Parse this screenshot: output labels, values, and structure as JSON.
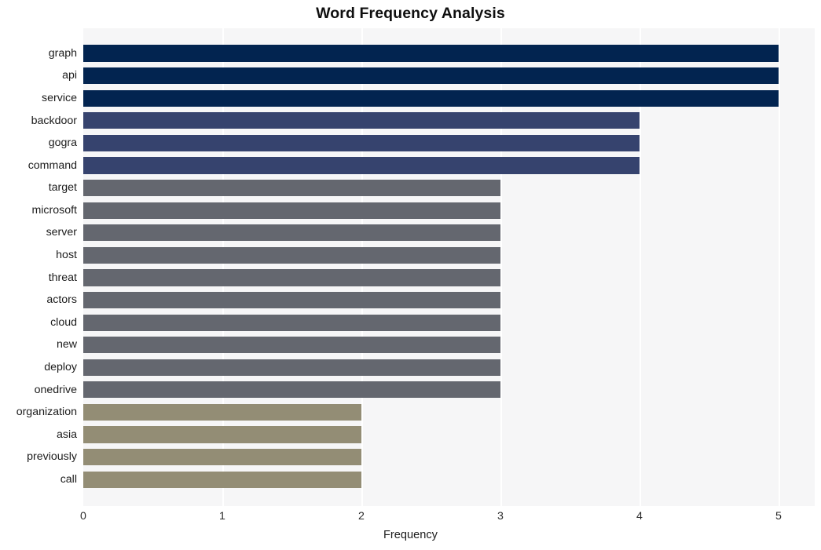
{
  "chart_data": {
    "type": "bar",
    "orientation": "horizontal",
    "title": "Word Frequency Analysis",
    "xlabel": "Frequency",
    "ylabel": "",
    "xlim": [
      0,
      5
    ],
    "xticks": [
      0,
      1,
      2,
      3,
      4,
      5
    ],
    "xtick_labels": [
      "0",
      "1",
      "2",
      "3",
      "4",
      "5"
    ],
    "grid": true,
    "grid_axis": "x",
    "legend": "none",
    "categories": [
      "graph",
      "api",
      "service",
      "backdoor",
      "gogra",
      "command",
      "target",
      "microsoft",
      "server",
      "host",
      "threat",
      "actors",
      "cloud",
      "new",
      "deploy",
      "onedrive",
      "organization",
      "asia",
      "previously",
      "call"
    ],
    "values": [
      5,
      5,
      5,
      4,
      4,
      4,
      3,
      3,
      3,
      3,
      3,
      3,
      3,
      3,
      3,
      3,
      2,
      2,
      2,
      2
    ],
    "bar_colors": [
      "#022450",
      "#022450",
      "#022450",
      "#36436e",
      "#36436e",
      "#36436e",
      "#64676f",
      "#64676f",
      "#64676f",
      "#64676f",
      "#64676f",
      "#64676f",
      "#64676f",
      "#64676f",
      "#64676f",
      "#64676f",
      "#938d75",
      "#938d75",
      "#938d75",
      "#938d75"
    ]
  },
  "style": {
    "plot_background": "#f6f6f7",
    "figure_background": "#ffffff",
    "gridline_color": "#ffffff",
    "title_color": "#0f0f0f",
    "tick_label_color": "#1c1c1c"
  }
}
